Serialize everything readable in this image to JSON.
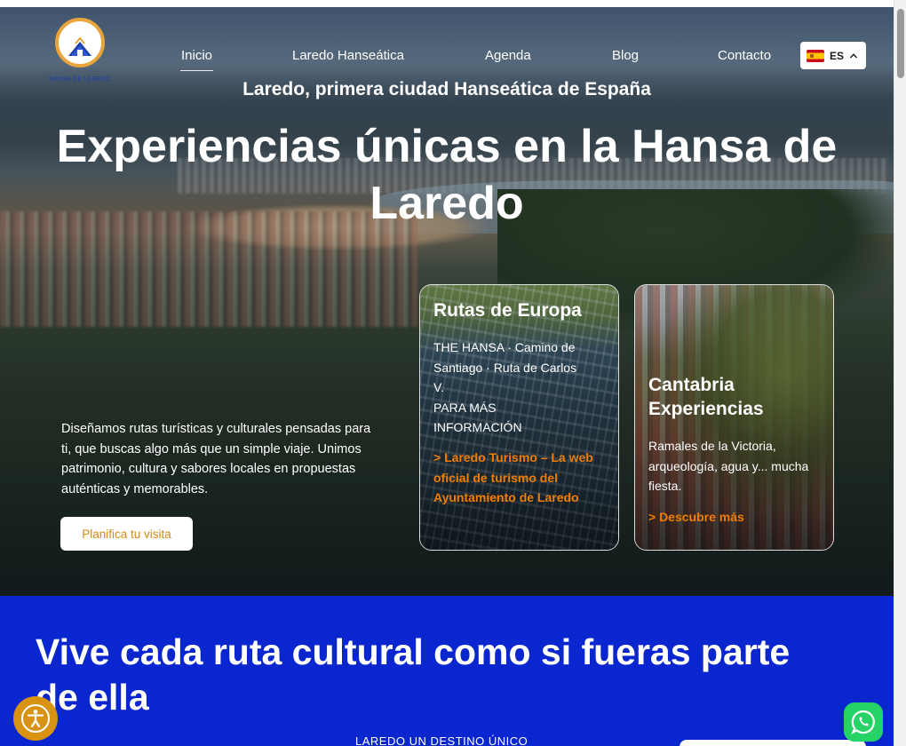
{
  "brand": {
    "logo_text": "HANSA DE LAREDO"
  },
  "nav": {
    "items": [
      {
        "label": "Inicio",
        "active": true
      },
      {
        "label": "Laredo Hanseática",
        "active": false
      },
      {
        "label": "Agenda",
        "active": false
      },
      {
        "label": "Blog",
        "active": false
      },
      {
        "label": "Contacto",
        "active": false
      }
    ],
    "language": {
      "code": "ES",
      "flag_icon": "spain-flag-icon",
      "chevron_icon": "chevron-up-icon"
    }
  },
  "hero": {
    "eyebrow": "Laredo, primera ciudad Hanseática de España",
    "title": "Experiencias únicas en la Hansa de Laredo",
    "description": "Diseñamos rutas turísticas y culturales pensadas para ti, que buscas algo más que un simple viaje. Unimos patrimonio, cultura y sabores locales en propuestas auténticas y memorables.",
    "cta_label": "Planifica tu visita"
  },
  "cards": [
    {
      "title": "Rutas de Europa",
      "text_line1": "THE HANSA · Camino de Santiago · Ruta de Carlos V.",
      "text_line2": "PARA MÁS INFORMACIÓN",
      "link": "> Laredo Turismo – La web oficial de turismo del Ayuntamiento de Laredo"
    },
    {
      "title": "Cantabria Experiencias",
      "text": "Ramales de la Victoria, arqueología, agua y... mucha fiesta.",
      "link": "> Descubre más"
    }
  ],
  "section": {
    "title": "Vive cada ruta cultural como si fueras parte de ella",
    "subtitle": "LAREDO UN DESTINO ÚNICO"
  },
  "floating": {
    "accessibility_icon": "accessibility-icon",
    "whatsapp_icon": "whatsapp-icon"
  },
  "colors": {
    "accent_orange": "#f07d00",
    "cta_text": "#d08a16",
    "section_blue": "#0a27cf",
    "accessibility_bg": "#d99313",
    "whatsapp_green": "#25d366"
  }
}
